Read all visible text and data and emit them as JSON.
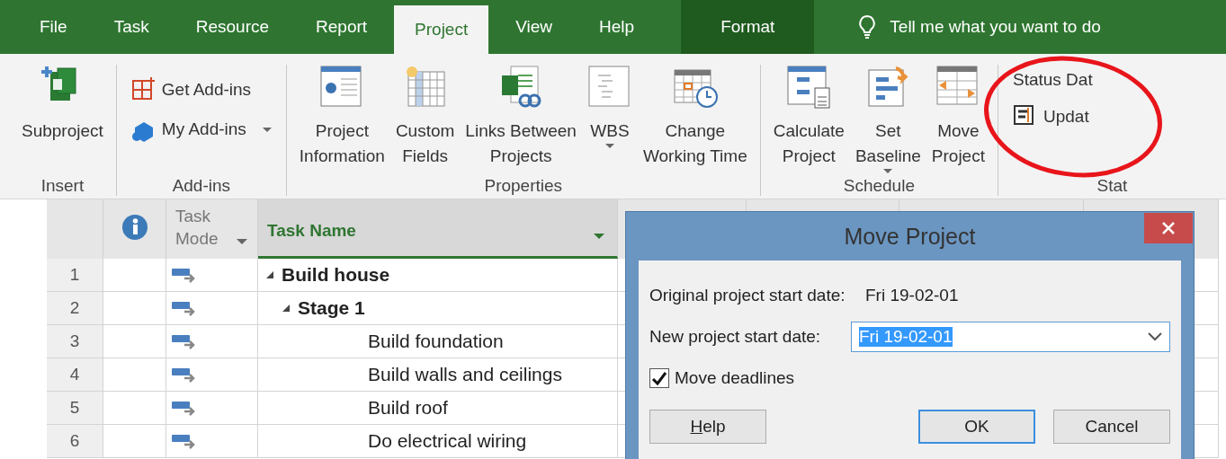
{
  "tabs": [
    {
      "label": "File",
      "selected": false,
      "kind": "normal"
    },
    {
      "label": "Task",
      "selected": false,
      "kind": "normal"
    },
    {
      "label": "Resource",
      "selected": false,
      "kind": "normal"
    },
    {
      "label": "Report",
      "selected": false,
      "kind": "normal"
    },
    {
      "label": "Project",
      "selected": true,
      "kind": "normal"
    },
    {
      "label": "View",
      "selected": false,
      "kind": "normal"
    },
    {
      "label": "Help",
      "selected": false,
      "kind": "normal"
    },
    {
      "label": "Format",
      "selected": false,
      "kind": "contextual"
    }
  ],
  "tell_me": {
    "placeholder": "Tell me what you want to do"
  },
  "ribbon": {
    "groups": [
      {
        "label": "Insert",
        "buttons": [
          {
            "label": "Subproject",
            "kind": "large",
            "has_dropdown": false
          }
        ]
      },
      {
        "label": "Add-ins",
        "buttons": [
          {
            "label": "Get Add-ins",
            "kind": "small",
            "has_dropdown": false
          },
          {
            "label": "My Add-ins",
            "kind": "small",
            "has_dropdown": true
          }
        ]
      },
      {
        "label": "Properties",
        "buttons": [
          {
            "label": "Project\nInformation",
            "kind": "large",
            "has_dropdown": false
          },
          {
            "label": "Custom\nFields",
            "kind": "large",
            "has_dropdown": false
          },
          {
            "label": "Links Between\nProjects",
            "kind": "large",
            "has_dropdown": false
          },
          {
            "label": "WBS",
            "kind": "large",
            "has_dropdown": true
          },
          {
            "label": "Change\nWorking Time",
            "kind": "large",
            "has_dropdown": false
          }
        ]
      },
      {
        "label": "Schedule",
        "buttons": [
          {
            "label": "Calculate\nProject",
            "kind": "large",
            "has_dropdown": false
          },
          {
            "label": "Set\nBaseline",
            "kind": "large",
            "has_dropdown": true
          },
          {
            "label": "Move\nProject",
            "kind": "large",
            "has_dropdown": false
          }
        ]
      },
      {
        "label": "Stat",
        "buttons": [
          {
            "label": "Status Dat",
            "kind": "text"
          },
          {
            "label": "Updat",
            "kind": "small",
            "has_dropdown": false
          }
        ]
      }
    ]
  },
  "grid": {
    "columns": [
      {
        "kind": "info"
      },
      {
        "kind": "mode",
        "label": "Task\nMode"
      },
      {
        "kind": "name",
        "label": "Task Name"
      }
    ],
    "rows": [
      {
        "number": "1",
        "name": "Build house",
        "expanded": true,
        "children": [
          {
            "number": "2",
            "name": "Stage 1",
            "expanded": true,
            "children": [
              {
                "number": "3",
                "name": "Build foundation"
              },
              {
                "number": "4",
                "name": "Build walls and ceilings"
              },
              {
                "number": "5",
                "name": "Build roof"
              },
              {
                "number": "6",
                "name": "Do electrical wiring"
              }
            ]
          }
        ]
      }
    ]
  },
  "dialog": {
    "title": "Move Project",
    "original_label": "Original project start date:",
    "original_value": "Fri 19-02-01",
    "new_label": "New project start date:",
    "new_value": "Fri 19-02-01",
    "move_deadlines": {
      "label": "Move deadlines",
      "checked": true
    },
    "buttons": [
      {
        "label": "Help",
        "default": false
      },
      {
        "label": "OK",
        "default": true
      },
      {
        "label": "Cancel",
        "default": false
      }
    ]
  }
}
